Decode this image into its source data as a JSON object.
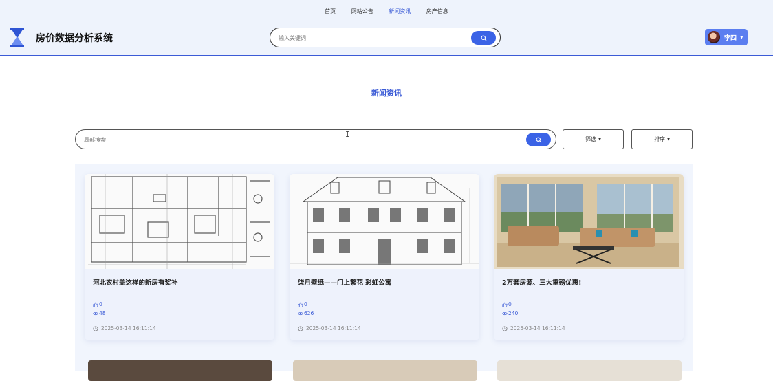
{
  "nav": {
    "items": [
      "首页",
      "网站公告",
      "新闻资讯",
      "房产信息"
    ],
    "active_index": 2
  },
  "site": {
    "title": "房价数据分析系统"
  },
  "top_search": {
    "placeholder": "输入关键词"
  },
  "user": {
    "name": "李四"
  },
  "section": {
    "title": "新闻资讯"
  },
  "local_search": {
    "placeholder": "局部搜索"
  },
  "filter": {
    "label": "筛选"
  },
  "sort": {
    "label": "排序"
  },
  "cards": [
    {
      "title": "河北农村盖这样的新房有奖补",
      "likes": "0",
      "views": "48",
      "time": "2025-03-14 16:11:14",
      "image": "floor-plan"
    },
    {
      "title": "柒月壁纸——门上繁花 彩虹公寓",
      "likes": "0",
      "views": "626",
      "time": "2025-03-14 16:11:14",
      "image": "building-elevation"
    },
    {
      "title": "2万套房源、三大重磅优惠!",
      "likes": "0",
      "views": "240",
      "time": "2025-03-14 16:11:14",
      "image": "living-room"
    }
  ],
  "colors": {
    "accent": "#3b5bd6",
    "button": "#3b63e6",
    "header_bg": "#eef3fc"
  }
}
